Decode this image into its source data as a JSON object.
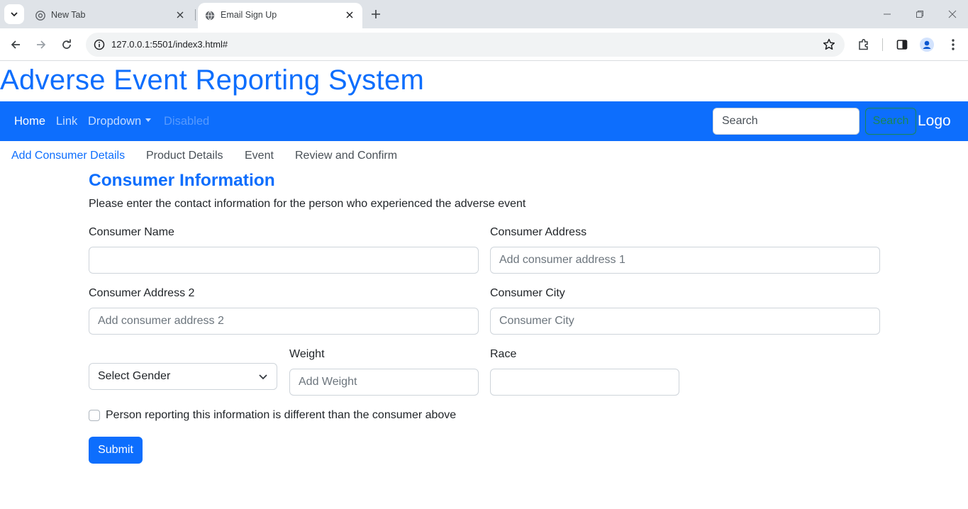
{
  "browser": {
    "tabs": [
      {
        "title": "New Tab",
        "active": false
      },
      {
        "title": "Email Sign Up",
        "active": true
      }
    ],
    "url": "127.0.0.1:5501/index3.html#",
    "icons": [
      "tab-list-icon",
      "chrome-icon",
      "globe-icon",
      "close-icon",
      "plus-icon",
      "minimize-icon",
      "restore-icon",
      "window-close-icon",
      "back-icon",
      "forward-icon",
      "reload-icon",
      "info-icon",
      "star-icon",
      "extensions-icon",
      "side-panel-icon",
      "profile-icon",
      "menu-icon"
    ]
  },
  "page": {
    "title": "Adverse Event Reporting System"
  },
  "navbar": {
    "links": [
      "Home",
      "Link",
      "Dropdown",
      "Disabled"
    ],
    "search_placeholder": "Search",
    "search_button": "Search",
    "brand": "Logo",
    "colors": {
      "bg": "#0d6efd",
      "search_btn": "#198754"
    }
  },
  "steps": [
    "Add Consumer Details",
    "Product Details",
    "Event",
    "Review and Confirm"
  ],
  "form": {
    "heading": "Consumer Information",
    "description": "Please enter the contact information for the person who experienced the adverse event",
    "consumer_name": {
      "label": "Consumer Name",
      "value": "",
      "placeholder": ""
    },
    "consumer_address": {
      "label": "Consumer Address",
      "placeholder": "Add consumer address 1"
    },
    "consumer_address2": {
      "label": "Consumer Address 2",
      "placeholder": "Add consumer address 2"
    },
    "consumer_city": {
      "label": "Consumer City",
      "placeholder": "Consumer City"
    },
    "gender": {
      "selected": "Select Gender"
    },
    "weight": {
      "label": "Weight",
      "placeholder": "Add Weight"
    },
    "race": {
      "label": "Race",
      "value": ""
    },
    "different_reporter": {
      "label": "Person reporting this information is different than the consumer above",
      "checked": false
    },
    "submit": "Submit"
  }
}
